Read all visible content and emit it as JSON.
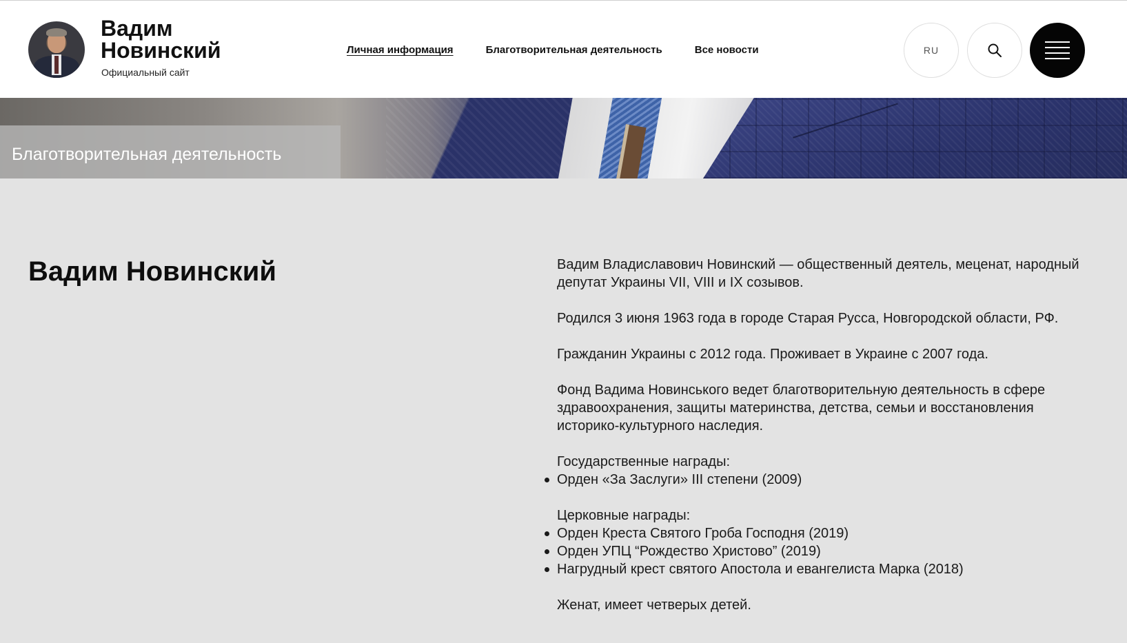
{
  "header": {
    "logo_name": "Вадим Новинский",
    "logo_subtitle": "Официальный сайт",
    "nav": [
      {
        "label": "Личная информация",
        "active": true
      },
      {
        "label": "Благотворительная деятельность",
        "active": false
      },
      {
        "label": "Все новости",
        "active": false
      }
    ],
    "lang_label": "RU",
    "search_icon": "search-icon",
    "menu_icon": "hamburger-icon"
  },
  "banner": {
    "title": "Благотворительная деятельность"
  },
  "main": {
    "name": "Вадим Новинский",
    "bio": {
      "p1": "Вадим Владиславович Новинский — общественный деятель, меценат, народный депутат Украины VII, VIII и IX созывов.",
      "p2": "Родился 3 июня 1963 года в городе Старая Русса, Новгородской области, РФ.",
      "p3": "Гражданин Украины с 2012 года. Проживает в Украине с 2007 года.",
      "p4": "Фонд Вадима Новинського ведет благотворительную деятельность в сфере здравоохранения, защиты материнства, детства, семьи и восстановления историко-культурного наследия.",
      "state_awards_heading": "Государственные награды:",
      "state_awards": [
        "Орден «За Заслуги» III степени (2009)"
      ],
      "church_awards_heading": "Церковные награды:",
      "church_awards": [
        "Орден Креста Святого Гроба Господня (2019)",
        "Орден УПЦ “Рождество Христово” (2019)",
        "Нагрудный крест святого Апостола и евангелиста Марка (2018)"
      ],
      "p5": "Женат, имеет четверых детей."
    }
  },
  "colors": {
    "page_bg": "#e3e3e3",
    "header_bg": "#ffffff",
    "menu_button_bg": "#050505",
    "banner_jacket": "#2b3468"
  }
}
